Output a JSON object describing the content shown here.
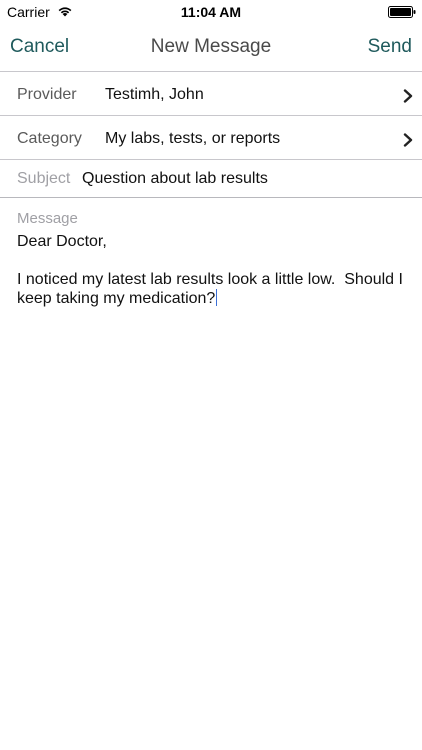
{
  "status_bar": {
    "carrier": "Carrier",
    "time": "11:04 AM",
    "wifi_icon": "wifi-icon",
    "battery_icon": "battery-icon"
  },
  "nav": {
    "cancel_label": "Cancel",
    "title": "New Message",
    "send_label": "Send",
    "accent_color": "#1f5a5c"
  },
  "form": {
    "provider": {
      "label": "Provider",
      "value": "Testimh, John",
      "icon": "chevron-right-icon"
    },
    "category": {
      "label": "Category",
      "value": "My labs, tests, or reports",
      "icon": "chevron-right-icon"
    },
    "subject": {
      "label": "Subject",
      "value": "Question about lab results"
    },
    "message": {
      "label": "Message",
      "value": "Dear Doctor,\n\nI noticed my latest lab results look a little low.  Should I keep taking my medication?"
    }
  }
}
